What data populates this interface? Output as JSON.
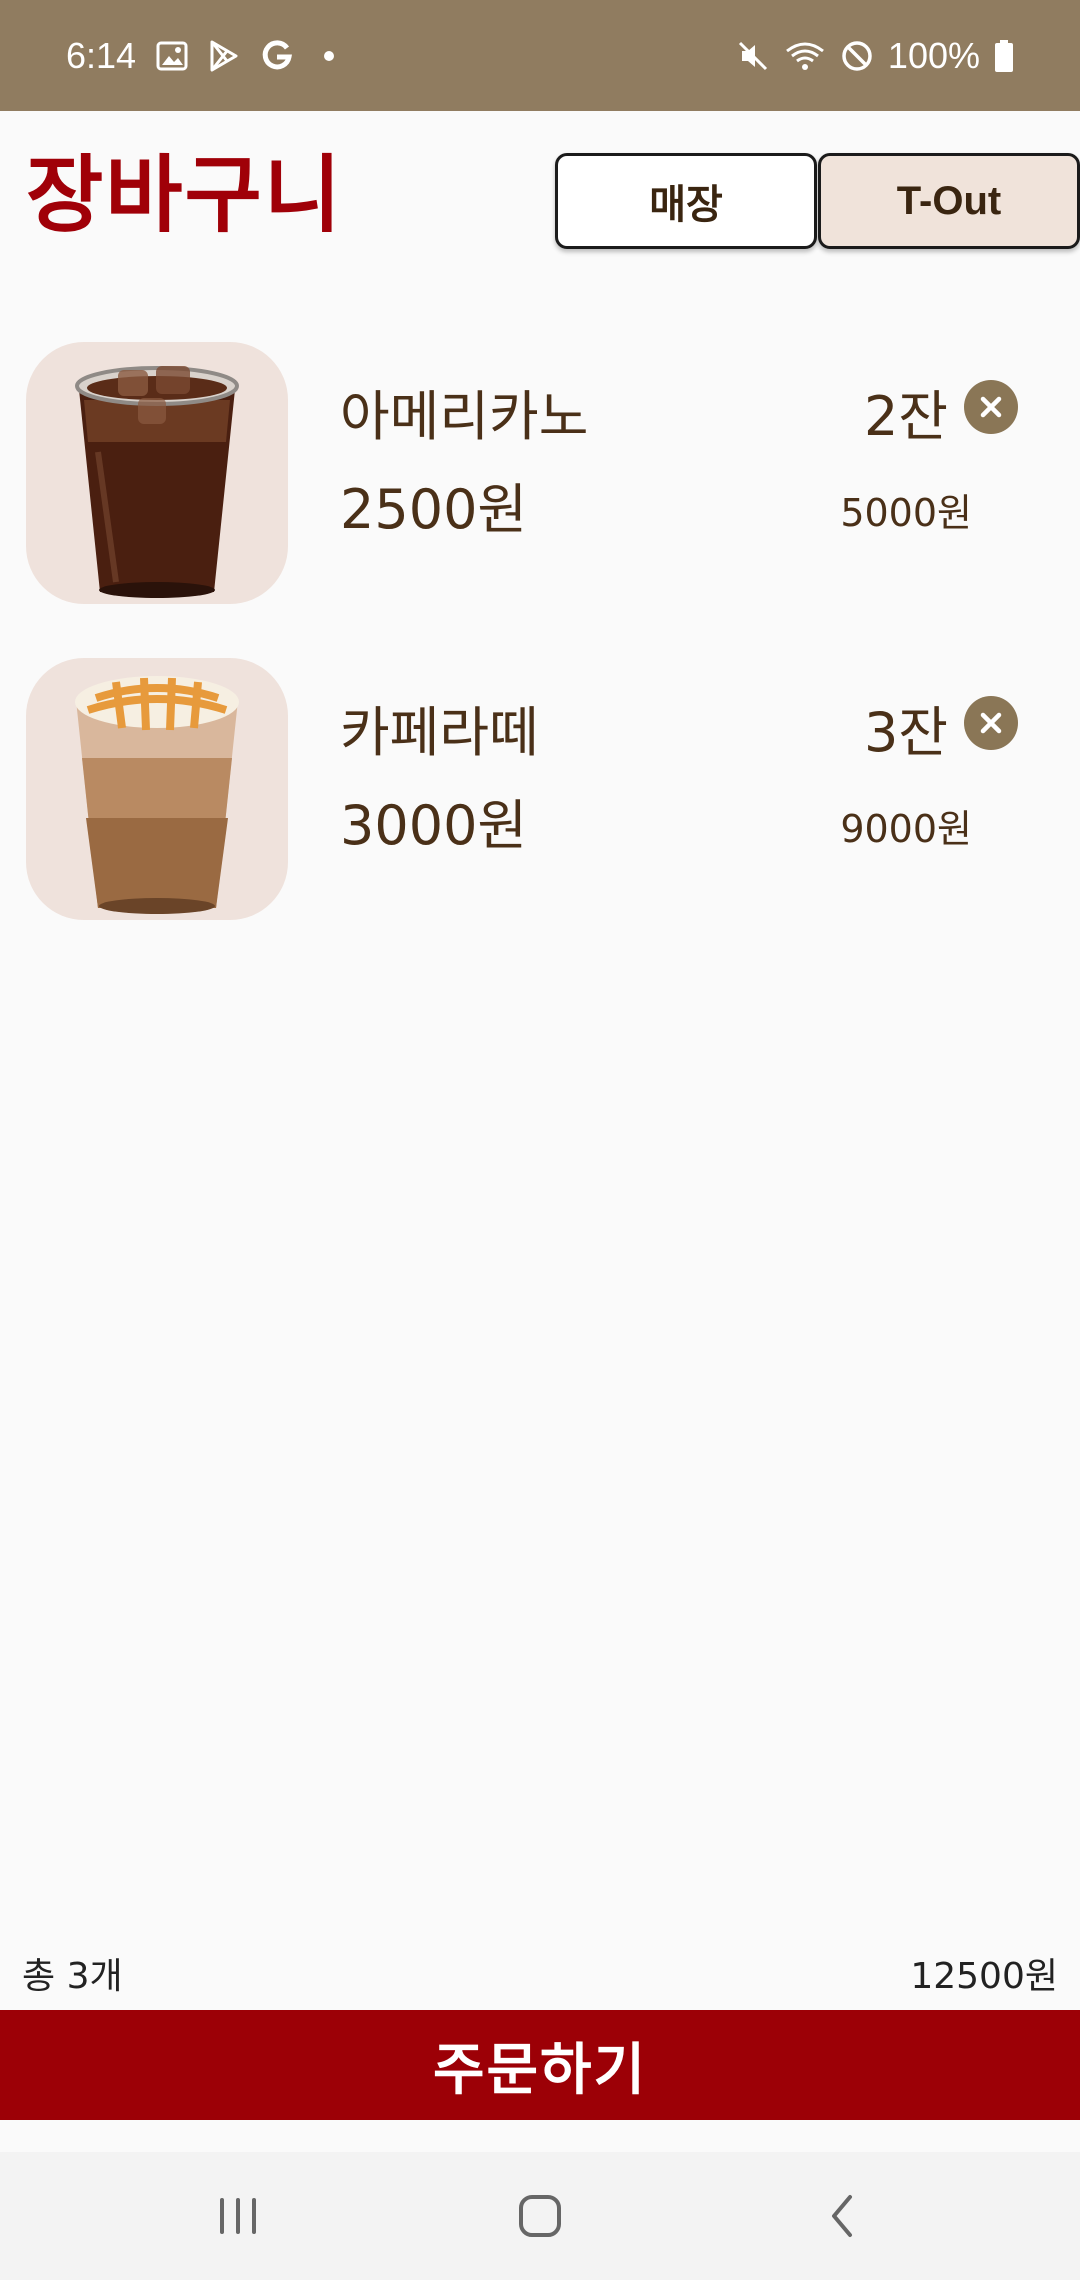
{
  "status_bar": {
    "time": "6:14",
    "battery": "100%",
    "icons": [
      "gallery-icon",
      "play-store-icon",
      "google-icon",
      "dot-icon",
      "mute-icon",
      "wifi-icon",
      "block-icon",
      "battery-icon"
    ]
  },
  "header": {
    "title": "장바구니",
    "dine_in_label": "매장",
    "take_out_label": "T-Out"
  },
  "cart": {
    "items": [
      {
        "name": "아메리카노",
        "price": "2500원",
        "qty": "2잔",
        "subtotal": "5000원",
        "thumb": "iced-americano-image"
      },
      {
        "name": "카페라떼",
        "price": "3000원",
        "qty": "3잔",
        "subtotal": "9000원",
        "thumb": "iced-caramel-latte-image"
      }
    ]
  },
  "summary": {
    "count": "총 3개",
    "total": "12500원"
  },
  "order_button": "주문하기",
  "colors": {
    "status_bar": "#907c60",
    "title": "#a00008",
    "order_button": "#9c0006",
    "remove_button": "#8a7656",
    "thumb_bg": "#efe2dc",
    "take_out_bg": "#f0e3da"
  },
  "nav_bar": {
    "icons": [
      "recent-apps-icon",
      "home-icon",
      "back-icon"
    ]
  }
}
